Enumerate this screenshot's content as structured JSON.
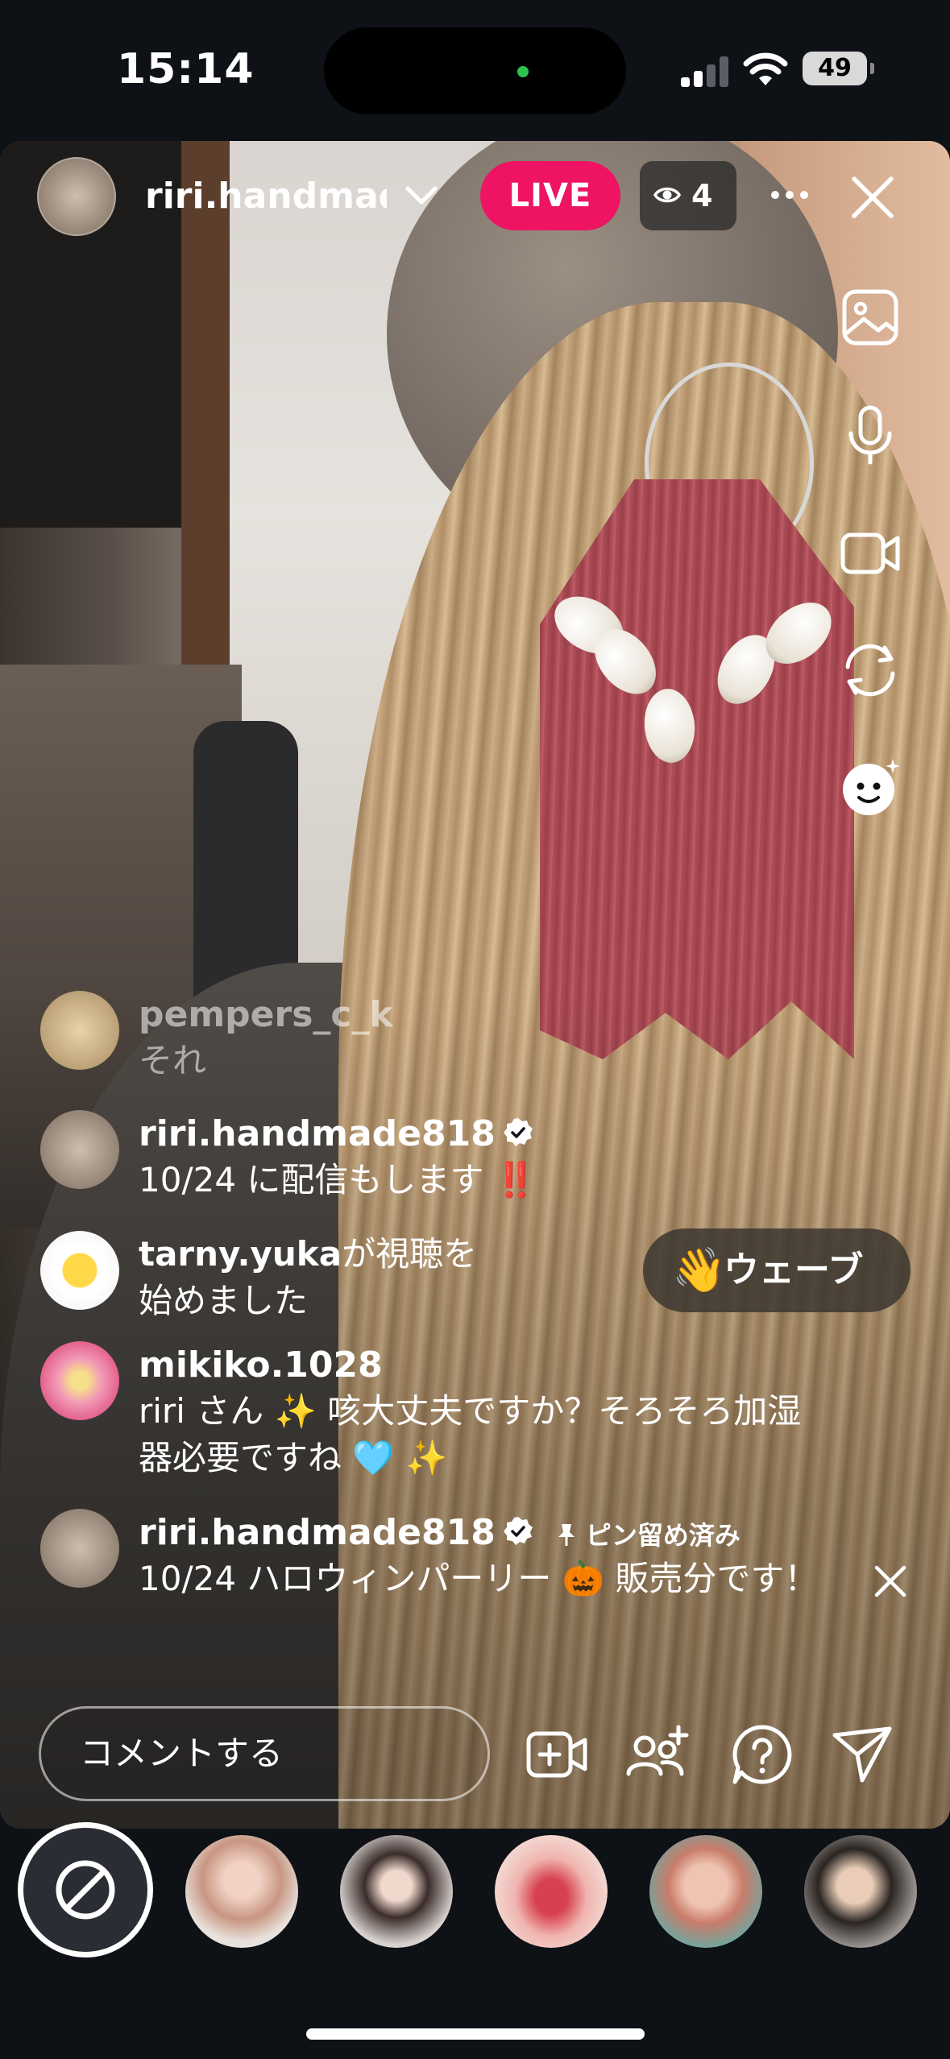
{
  "status_bar": {
    "time": "15:14",
    "battery": "49"
  },
  "header": {
    "host_name": "riri.handmade818",
    "live_label": "LIVE",
    "viewer_count": "4"
  },
  "comments": [
    {
      "user": "pempers_c_k",
      "text": "それ",
      "faded": true
    },
    {
      "user": "riri.handmade818",
      "verified": true,
      "text": "10/24 に配信もします ‼️"
    },
    {
      "user": "tarny.yuka",
      "joined_suffix": "が視聴を",
      "joined_line2": "始めました"
    },
    {
      "user": "mikiko.1028",
      "text": "riri さん ✨ 咳大丈夫ですか？そろそろ加湿",
      "text_line2": "器必要ですね 🩵 ✨"
    },
    {
      "user": "riri.handmade818",
      "verified": true,
      "pinned_label": "ピン留め済み",
      "text": "10/24 ハロウィンパーリー 🎃 販売分です！"
    }
  ],
  "wave_button": {
    "icon": "👋",
    "label": "ウェーブ"
  },
  "comment_input": {
    "placeholder": "コメントする"
  },
  "icons": {
    "right_tools": [
      "image-icon",
      "microphone-icon",
      "video-camera-icon",
      "flip-camera-icon",
      "face-effects-icon"
    ],
    "bottom": [
      "add-video-icon",
      "invite-icon",
      "question-icon",
      "send-icon"
    ]
  },
  "colors": {
    "live": "#ee1463",
    "background": "#0e1116"
  }
}
